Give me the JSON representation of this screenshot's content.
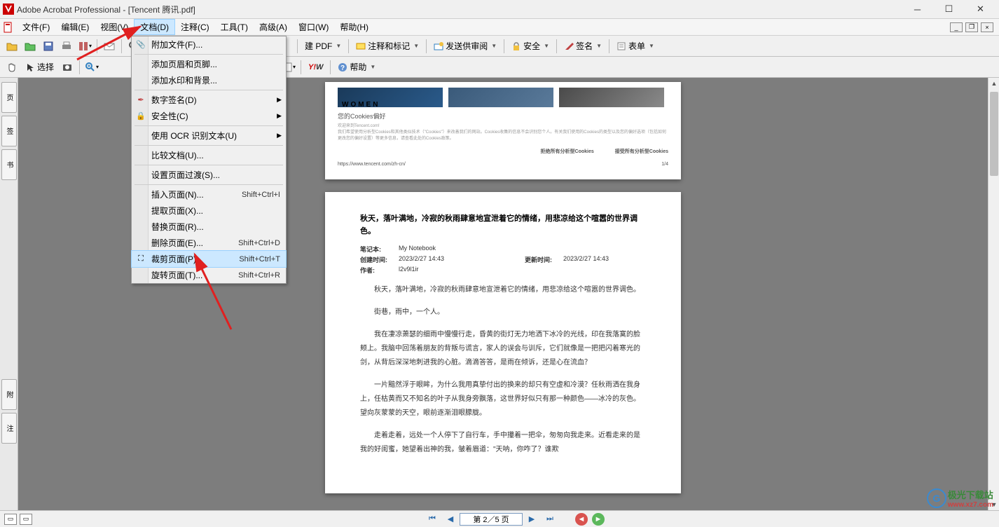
{
  "titlebar": {
    "title": "Adobe Acrobat Professional - [Tencent 腾讯.pdf]"
  },
  "menubar": {
    "items": [
      {
        "label": "文件(F)"
      },
      {
        "label": "编辑(E)"
      },
      {
        "label": "视图(V)"
      },
      {
        "label": "文档(D)"
      },
      {
        "label": "注释(C)"
      },
      {
        "label": "工具(T)"
      },
      {
        "label": "高级(A)"
      },
      {
        "label": "窗口(W)"
      },
      {
        "label": "帮助(H)"
      }
    ]
  },
  "toolbar1": {
    "create_pdf": "建 PDF",
    "annotate": "注释和标记",
    "send_review": "发送供审阅",
    "security": "安全",
    "sign": "签名",
    "forms": "表单"
  },
  "toolbar2": {
    "select": "选择",
    "help": "帮助"
  },
  "dropdown": {
    "items": [
      {
        "icon": "📎",
        "label": "附加文件(F)...",
        "shortcut": "",
        "arrow": false
      },
      {
        "sep": true
      },
      {
        "icon": "",
        "label": "添加页眉和页脚...",
        "shortcut": "",
        "arrow": false
      },
      {
        "icon": "",
        "label": "添加水印和背景...",
        "shortcut": "",
        "arrow": false
      },
      {
        "sep": true
      },
      {
        "icon": "✒",
        "label": "数字签名(D)",
        "shortcut": "",
        "arrow": true
      },
      {
        "icon": "🔒",
        "label": "安全性(C)",
        "shortcut": "",
        "arrow": true
      },
      {
        "sep": true
      },
      {
        "icon": "",
        "label": "使用 OCR 识别文本(U)",
        "shortcut": "",
        "arrow": true
      },
      {
        "sep": true
      },
      {
        "icon": "",
        "label": "比较文档(U)...",
        "shortcut": "",
        "arrow": false
      },
      {
        "sep": true
      },
      {
        "icon": "",
        "label": "设置页面过渡(S)...",
        "shortcut": "",
        "arrow": false
      },
      {
        "sep": true
      },
      {
        "icon": "",
        "label": "插入页面(N)...",
        "shortcut": "Shift+Ctrl+I",
        "arrow": false
      },
      {
        "icon": "",
        "label": "提取页面(X)...",
        "shortcut": "",
        "arrow": false
      },
      {
        "icon": "",
        "label": "替换页面(R)...",
        "shortcut": "",
        "arrow": false
      },
      {
        "icon": "",
        "label": "删除页面(E)...",
        "shortcut": "Shift+Ctrl+D",
        "arrow": false
      },
      {
        "icon": "✂",
        "label": "裁剪页面(P)...",
        "shortcut": "Shift+Ctrl+T",
        "arrow": false,
        "highlighted": true
      },
      {
        "icon": "",
        "label": "旋转页面(T)...",
        "shortcut": "Shift+Ctrl+R",
        "arrow": false
      }
    ]
  },
  "page1": {
    "women": "WOMEN",
    "cookie_title": "您的Cookies偏好",
    "cookie_welcome": "欢迎来到Tencent.com!",
    "cookie_body": "我们希望使用分析型Cookies和其他类似技术（\"Cookies\"）来改善我们的网站。Cookies收集的信息不会识别您个人。有关我们使用的Cookies的类型以及您的偏好选项（包括如何更改您的偏好设置）等更多信息，请查看此处的Cookies政策。",
    "btn_reject": "拒绝所有分析型Cookies",
    "btn_accept": "接受所有分析型Cookies",
    "url": "https://www.tencent.com/zh-cn/",
    "pagenum": "1/4"
  },
  "page2": {
    "title": "秋天，落叶满地，冷寂的秋雨肆意地宣泄着它的情绪，用悲凉给这个喧嚣的世界调色。",
    "meta": {
      "notebook_label": "笔记本:",
      "notebook_val": "My Notebook",
      "created_label": "创建时间:",
      "created_val": "2023/2/27 14:43",
      "updated_label": "更新时间:",
      "updated_val": "2023/2/27 14:43",
      "author_label": "作者:",
      "author_val": "l2v9l1ir"
    },
    "para1": "秋天，落叶满地，冷寂的秋雨肆意地宣泄着它的情绪，用悲凉给这个喧嚣的世界调色。",
    "para2": "街巷，雨中，一个人。",
    "para3": "我在凄凉萧瑟的细雨中慢慢行走，昏黄的街灯无力地洒下冰冷的光线，印在我落寞的脸颊上。我脑中回荡着朋友的背叛与谎言，家人的误会与训斥，它们就像是一把把闪着寒光的剑，从背后深深地刺进我的心脏。滴滴答答，是雨在倾诉，还是心在流血？",
    "para4": "一片黯然浮于眼眸，为什么我用真挚付出的换来的却只有空虚和冷漠？任秋雨洒在我身上，任枯黄而又不知名的叶子从我身旁飘落，这世界好似只有那一种颜色——冰冷的灰色。望向灰蒙蒙的天空，眼前逐渐泪眼朦胧。",
    "para5": "走着走着，远处一个人停下了自行车，手中攥着一把伞，匆匆向我走来。近看走来的是我的好闺蜜，她望着出神的我，皱着眉道：\"天呐，你咋了？谁欺"
  },
  "statusbar": {
    "page_display": "第 2／5 页"
  },
  "watermark": {
    "text": "极光下载站",
    "url": "www.xz7.com"
  }
}
